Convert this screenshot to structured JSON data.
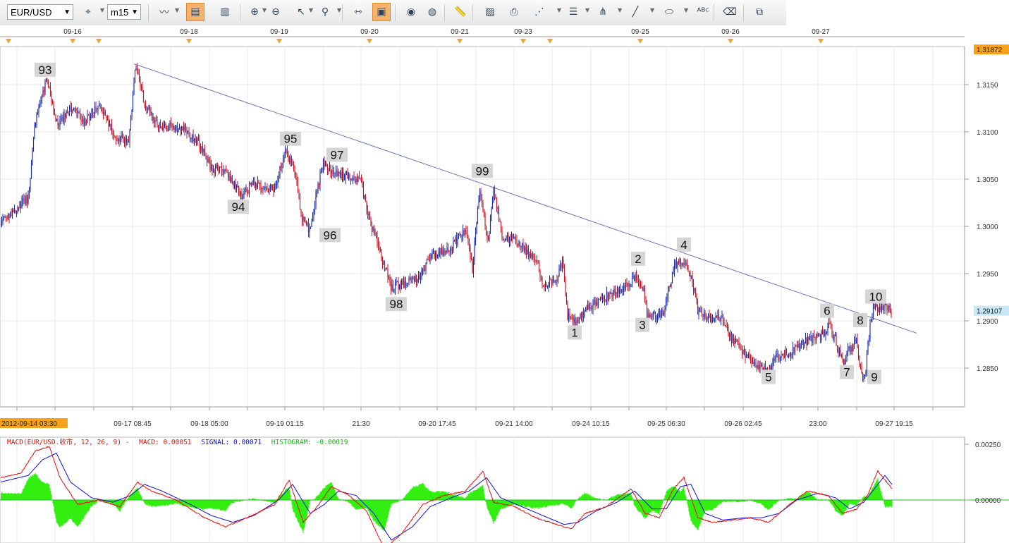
{
  "toolbar": {
    "symbol": "EUR/USD",
    "timeframe": "m15",
    "buttons": [
      {
        "name": "crosshair-remove-icon",
        "glyph": "⌖",
        "active": false
      },
      {
        "name": "chart-type-icon",
        "glyph": "〰",
        "active": false
      },
      {
        "name": "data-window-icon",
        "glyph": "▤",
        "active": true
      },
      {
        "name": "indicator-window-icon",
        "glyph": "▥",
        "active": false
      },
      {
        "name": "zoom-in-icon",
        "glyph": "⊕",
        "active": false
      },
      {
        "name": "zoom-out-icon",
        "glyph": "⊖",
        "active": false
      },
      {
        "name": "cursor-icon",
        "glyph": "↖",
        "active": false
      },
      {
        "name": "magnifier-icon",
        "glyph": "⚲",
        "active": false
      },
      {
        "name": "auto-scroll-icon",
        "glyph": "⇿",
        "active": false
      },
      {
        "name": "template-icon",
        "glyph": "▣",
        "active": true
      },
      {
        "name": "eye-icon",
        "glyph": "◉",
        "active": false
      },
      {
        "name": "globe-icon",
        "glyph": "◍",
        "active": false
      },
      {
        "name": "ruler-icon",
        "glyph": "📏",
        "active": false
      },
      {
        "name": "picture-icon",
        "glyph": "▨",
        "active": false
      },
      {
        "name": "print-icon",
        "glyph": "⎙",
        "active": false
      },
      {
        "name": "fibonacci-fan-icon",
        "glyph": "⋰",
        "active": false
      },
      {
        "name": "horizontal-lines-icon",
        "glyph": "☰",
        "active": false
      },
      {
        "name": "pitchfork-icon",
        "glyph": "⋔",
        "active": false
      },
      {
        "name": "trendline-icon",
        "glyph": "╱",
        "active": false
      },
      {
        "name": "ellipse-icon",
        "glyph": "⬭",
        "active": false
      },
      {
        "name": "text-label-icon",
        "glyph": "ᴬᴮᶜ",
        "active": false
      },
      {
        "name": "eraser-icon",
        "glyph": "⌫",
        "active": false
      },
      {
        "name": "tree-structure-icon",
        "glyph": "⧉",
        "active": false
      }
    ]
  },
  "colors": {
    "up_candle": "#1d2fa8",
    "down_candle": "#c0182a",
    "trendline": "#6e72b3",
    "macd_line": "#e01010",
    "signal_line": "#1010d0",
    "histogram": "#33ee11",
    "zero_line": "#22bb22",
    "current_price_bg": "#c8e8f8",
    "high_price_bg": "#f7a21b",
    "start_date_bg": "#f7a21b",
    "wave_label_bg": "#d5d5d5"
  },
  "chart_data": [
    {
      "type": "candlestick",
      "symbol": "EUR/USD",
      "timeframe": "m15",
      "y_range": [
        1.28,
        1.319
      ],
      "y_ticks": [
        "1.2850",
        "1.2900",
        "1.2950",
        "1.3000",
        "1.3050",
        "1.3100",
        "1.3150"
      ],
      "current_price": "1.29107",
      "high_price": "1.31872",
      "top_date_ticks": [
        "09-16",
        "09-18",
        "09-19",
        "09-20",
        "09-21",
        "09-23",
        "09-25",
        "09-26",
        "09-27"
      ],
      "bottom_time_ticks": [
        "09-17 08:45",
        "09-18 05:00",
        "09-19 01:15",
        "21:30",
        "09-20 17:45",
        "09-21 14:00",
        "09-24 10:15",
        "09-25 06:30",
        "09-26 02:45",
        "23:00",
        "09-27 19:15"
      ],
      "start_date": "2012-09-14 03:30",
      "grid": true,
      "key_points": [
        {
          "x": 0,
          "y": 1.3005
        },
        {
          "x": 40,
          "y": 1.303
        },
        {
          "x": 50,
          "y": 1.311
        },
        {
          "x": 66,
          "y": 1.3155
        },
        {
          "x": 82,
          "y": 1.3105
        },
        {
          "x": 100,
          "y": 1.3125
        },
        {
          "x": 120,
          "y": 1.311
        },
        {
          "x": 140,
          "y": 1.313
        },
        {
          "x": 165,
          "y": 1.3095
        },
        {
          "x": 183,
          "y": 1.309
        },
        {
          "x": 192,
          "y": 1.317
        },
        {
          "x": 205,
          "y": 1.313
        },
        {
          "x": 225,
          "y": 1.3105
        },
        {
          "x": 260,
          "y": 1.3105
        },
        {
          "x": 290,
          "y": 1.308
        },
        {
          "x": 300,
          "y": 1.306
        },
        {
          "x": 320,
          "y": 1.306
        },
        {
          "x": 342,
          "y": 1.3033
        },
        {
          "x": 360,
          "y": 1.3045
        },
        {
          "x": 390,
          "y": 1.304
        },
        {
          "x": 405,
          "y": 1.308
        },
        {
          "x": 418,
          "y": 1.306
        },
        {
          "x": 428,
          "y": 1.301
        },
        {
          "x": 440,
          "y": 1.2995
        },
        {
          "x": 448,
          "y": 1.303
        },
        {
          "x": 458,
          "y": 1.307
        },
        {
          "x": 475,
          "y": 1.3055
        },
        {
          "x": 510,
          "y": 1.305
        },
        {
          "x": 525,
          "y": 1.3005
        },
        {
          "x": 540,
          "y": 1.297
        },
        {
          "x": 555,
          "y": 1.2935
        },
        {
          "x": 575,
          "y": 1.294
        },
        {
          "x": 595,
          "y": 1.2945
        },
        {
          "x": 610,
          "y": 1.297
        },
        {
          "x": 635,
          "y": 1.2975
        },
        {
          "x": 660,
          "y": 1.2995
        },
        {
          "x": 670,
          "y": 1.2955
        },
        {
          "x": 680,
          "y": 1.304
        },
        {
          "x": 692,
          "y": 1.2985
        },
        {
          "x": 700,
          "y": 1.304
        },
        {
          "x": 712,
          "y": 1.299
        },
        {
          "x": 730,
          "y": 1.2985
        },
        {
          "x": 745,
          "y": 1.2975
        },
        {
          "x": 763,
          "y": 1.296
        },
        {
          "x": 770,
          "y": 1.2935
        },
        {
          "x": 790,
          "y": 1.2945
        },
        {
          "x": 798,
          "y": 1.2965
        },
        {
          "x": 805,
          "y": 1.2905
        },
        {
          "x": 815,
          "y": 1.2898
        },
        {
          "x": 825,
          "y": 1.2905
        },
        {
          "x": 835,
          "y": 1.2915
        },
        {
          "x": 850,
          "y": 1.292
        },
        {
          "x": 870,
          "y": 1.293
        },
        {
          "x": 885,
          "y": 1.2935
        },
        {
          "x": 900,
          "y": 1.2945
        },
        {
          "x": 912,
          "y": 1.2935
        },
        {
          "x": 918,
          "y": 1.2905
        },
        {
          "x": 930,
          "y": 1.2905
        },
        {
          "x": 942,
          "y": 1.291
        },
        {
          "x": 955,
          "y": 1.2955
        },
        {
          "x": 965,
          "y": 1.2965
        },
        {
          "x": 980,
          "y": 1.295
        },
        {
          "x": 990,
          "y": 1.291
        },
        {
          "x": 1010,
          "y": 1.29
        },
        {
          "x": 1022,
          "y": 1.2905
        },
        {
          "x": 1035,
          "y": 1.2885
        },
        {
          "x": 1050,
          "y": 1.287
        },
        {
          "x": 1065,
          "y": 1.286
        },
        {
          "x": 1080,
          "y": 1.285
        },
        {
          "x": 1090,
          "y": 1.2848
        },
        {
          "x": 1100,
          "y": 1.286
        },
        {
          "x": 1115,
          "y": 1.2865
        },
        {
          "x": 1135,
          "y": 1.2875
        },
        {
          "x": 1150,
          "y": 1.288
        },
        {
          "x": 1165,
          "y": 1.2885
        },
        {
          "x": 1175,
          "y": 1.2895
        },
        {
          "x": 1185,
          "y": 1.288
        },
        {
          "x": 1195,
          "y": 1.2855
        },
        {
          "x": 1205,
          "y": 1.287
        },
        {
          "x": 1215,
          "y": 1.2878
        },
        {
          "x": 1220,
          "y": 1.285
        },
        {
          "x": 1226,
          "y": 1.2835
        },
        {
          "x": 1233,
          "y": 1.289
        },
        {
          "x": 1238,
          "y": 1.2915
        },
        {
          "x": 1250,
          "y": 1.2915
        },
        {
          "x": 1265,
          "y": 1.2911
        }
      ],
      "wave_labels": [
        {
          "text": "93",
          "x": 64,
          "y": 1.3165
        },
        {
          "text": "94",
          "x": 338,
          "y": 1.302
        },
        {
          "text": "95",
          "x": 412,
          "y": 1.3092
        },
        {
          "text": "96",
          "x": 468,
          "y": 1.299
        },
        {
          "text": "97",
          "x": 478,
          "y": 1.3075
        },
        {
          "text": "98",
          "x": 562,
          "y": 1.2917
        },
        {
          "text": "99",
          "x": 684,
          "y": 1.3058
        },
        {
          "text": "1",
          "x": 815,
          "y": 1.2887
        },
        {
          "text": "2",
          "x": 905,
          "y": 1.2965
        },
        {
          "text": "3",
          "x": 911,
          "y": 1.2895
        },
        {
          "text": "4",
          "x": 970,
          "y": 1.298
        },
        {
          "text": "5",
          "x": 1090,
          "y": 1.284
        },
        {
          "text": "6",
          "x": 1173,
          "y": 1.291
        },
        {
          "text": "7",
          "x": 1201,
          "y": 1.2845
        },
        {
          "text": "8",
          "x": 1220,
          "y": 1.29
        },
        {
          "text": "9",
          "x": 1240,
          "y": 1.284
        },
        {
          "text": "10",
          "x": 1242,
          "y": 1.2925
        }
      ],
      "trendline": {
        "from": {
          "x": 190,
          "y": 1.3172
        },
        "to": {
          "x": 1300,
          "y": 1.2887
        }
      }
    },
    {
      "type": "line",
      "indicator": "MACD",
      "label": "MACD(EUR/USD.收市, 12, 26, 9) -",
      "macd_label": "MACD: 0.00051",
      "signal_label": "SIGNAL: 0.00071",
      "histogram_label": "HISTOGRAM: -0.00019",
      "y_ticks": [
        "0.00250",
        "0.00000"
      ],
      "y_range": [
        -0.0024,
        0.0026
      ],
      "macd_key_points": [
        {
          "x": 0,
          "y": 0.001
        },
        {
          "x": 30,
          "y": 0.0012
        },
        {
          "x": 50,
          "y": 0.0022
        },
        {
          "x": 70,
          "y": 0.0024
        },
        {
          "x": 85,
          "y": 0.001
        },
        {
          "x": 110,
          "y": -0.0002
        },
        {
          "x": 140,
          "y": 0.0
        },
        {
          "x": 170,
          "y": -0.0003
        },
        {
          "x": 195,
          "y": 0.0008
        },
        {
          "x": 215,
          "y": 0.0004
        },
        {
          "x": 250,
          "y": 0.0
        },
        {
          "x": 290,
          "y": -0.0008
        },
        {
          "x": 320,
          "y": -0.0012
        },
        {
          "x": 350,
          "y": -0.0008
        },
        {
          "x": 390,
          "y": -0.0002
        },
        {
          "x": 410,
          "y": 0.0009
        },
        {
          "x": 430,
          "y": -0.001
        },
        {
          "x": 450,
          "y": -0.0003
        },
        {
          "x": 470,
          "y": 0.0006
        },
        {
          "x": 495,
          "y": 0.0002
        },
        {
          "x": 520,
          "y": -0.0005
        },
        {
          "x": 545,
          "y": -0.0022
        },
        {
          "x": 570,
          "y": -0.0015
        },
        {
          "x": 600,
          "y": -0.0002
        },
        {
          "x": 630,
          "y": 0.0002
        },
        {
          "x": 660,
          "y": 0.0004
        },
        {
          "x": 685,
          "y": 0.0013
        },
        {
          "x": 700,
          "y": -0.0001
        },
        {
          "x": 730,
          "y": -0.0003
        },
        {
          "x": 760,
          "y": -0.0008
        },
        {
          "x": 780,
          "y": -0.001
        },
        {
          "x": 810,
          "y": -0.0013
        },
        {
          "x": 830,
          "y": -0.0006
        },
        {
          "x": 860,
          "y": -0.0003
        },
        {
          "x": 895,
          "y": 0.0005
        },
        {
          "x": 915,
          "y": -0.0006
        },
        {
          "x": 935,
          "y": -0.0008
        },
        {
          "x": 955,
          "y": 0.0005
        },
        {
          "x": 970,
          "y": 0.001
        },
        {
          "x": 990,
          "y": -0.0008
        },
        {
          "x": 1010,
          "y": -0.001
        },
        {
          "x": 1040,
          "y": -0.0009
        },
        {
          "x": 1065,
          "y": -0.0008
        },
        {
          "x": 1090,
          "y": -0.001
        },
        {
          "x": 1120,
          "y": -0.0002
        },
        {
          "x": 1145,
          "y": 0.0004
        },
        {
          "x": 1175,
          "y": 0.0002
        },
        {
          "x": 1195,
          "y": -0.0006
        },
        {
          "x": 1215,
          "y": -0.0004
        },
        {
          "x": 1230,
          "y": 0.0002
        },
        {
          "x": 1245,
          "y": 0.0013
        },
        {
          "x": 1265,
          "y": 0.0005
        }
      ],
      "signal_key_points": [
        {
          "x": 0,
          "y": 0.0008
        },
        {
          "x": 40,
          "y": 0.0011
        },
        {
          "x": 60,
          "y": 0.0018
        },
        {
          "x": 80,
          "y": 0.0021
        },
        {
          "x": 100,
          "y": 0.0008
        },
        {
          "x": 130,
          "y": 0.0001
        },
        {
          "x": 160,
          "y": -0.0001
        },
        {
          "x": 185,
          "y": 0.0002
        },
        {
          "x": 205,
          "y": 0.0007
        },
        {
          "x": 230,
          "y": 0.0004
        },
        {
          "x": 270,
          "y": -0.0002
        },
        {
          "x": 300,
          "y": -0.0007
        },
        {
          "x": 330,
          "y": -0.001
        },
        {
          "x": 360,
          "y": -0.0007
        },
        {
          "x": 395,
          "y": 0.0
        },
        {
          "x": 415,
          "y": 0.0007
        },
        {
          "x": 440,
          "y": -0.0006
        },
        {
          "x": 460,
          "y": -0.0002
        },
        {
          "x": 480,
          "y": 0.0004
        },
        {
          "x": 505,
          "y": 0.0002
        },
        {
          "x": 530,
          "y": -0.0006
        },
        {
          "x": 555,
          "y": -0.0018
        },
        {
          "x": 585,
          "y": -0.0012
        },
        {
          "x": 610,
          "y": -0.0003
        },
        {
          "x": 640,
          "y": 0.0001
        },
        {
          "x": 665,
          "y": 0.0004
        },
        {
          "x": 690,
          "y": 0.001
        },
        {
          "x": 710,
          "y": 0.0001
        },
        {
          "x": 740,
          "y": -0.0003
        },
        {
          "x": 770,
          "y": -0.0007
        },
        {
          "x": 800,
          "y": -0.0011
        },
        {
          "x": 820,
          "y": -0.001
        },
        {
          "x": 845,
          "y": -0.0005
        },
        {
          "x": 875,
          "y": -0.0001
        },
        {
          "x": 900,
          "y": 0.0004
        },
        {
          "x": 925,
          "y": -0.0004
        },
        {
          "x": 945,
          "y": -0.0004
        },
        {
          "x": 965,
          "y": 0.0006
        },
        {
          "x": 980,
          "y": 0.0007
        },
        {
          "x": 1000,
          "y": -0.0006
        },
        {
          "x": 1025,
          "y": -0.0009
        },
        {
          "x": 1055,
          "y": -0.0008
        },
        {
          "x": 1080,
          "y": -0.0008
        },
        {
          "x": 1105,
          "y": -0.0006
        },
        {
          "x": 1130,
          "y": 0.0
        },
        {
          "x": 1160,
          "y": 0.0003
        },
        {
          "x": 1185,
          "y": 0.0001
        },
        {
          "x": 1205,
          "y": -0.0004
        },
        {
          "x": 1225,
          "y": -0.0001
        },
        {
          "x": 1240,
          "y": 0.0005
        },
        {
          "x": 1255,
          "y": 0.0011
        },
        {
          "x": 1265,
          "y": 0.0007
        }
      ]
    }
  ]
}
